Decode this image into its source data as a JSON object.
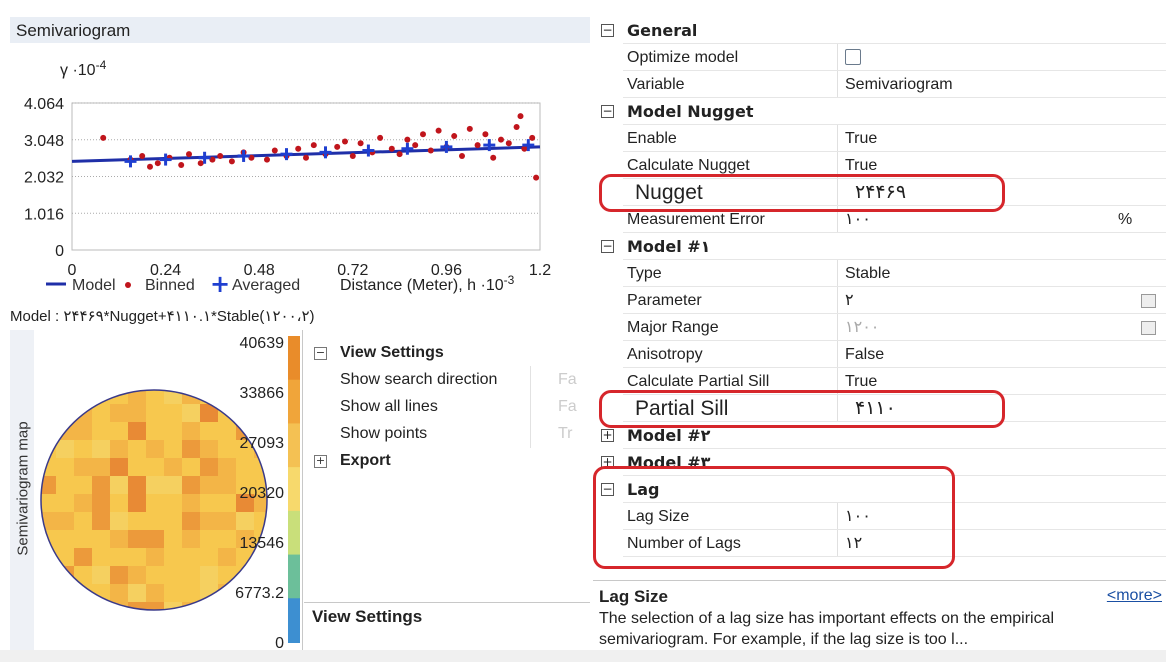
{
  "semivariogram": {
    "title": "Semivariogram",
    "y_unit": "γ ·10",
    "y_exp": "-4",
    "x_title": "Distance (Meter), h ·10",
    "x_exp": "-3",
    "legend": {
      "model": "Model",
      "binned": "Binned",
      "averaged": "Averaged"
    },
    "model_formula": "Model : ۲۴۴۶۹*Nugget+۴۱۱۰.۱*Stable(۱۲۰۰،۲)",
    "colors": {
      "model": "#1f2fa8",
      "binned": "#c0151c",
      "averaged": "#1f3fd0"
    }
  },
  "chart_data": {
    "type": "scatter",
    "title": "Semivariogram",
    "xlabel": "Distance (Meter), h ·10^-3",
    "ylabel": "γ ·10^-4",
    "xlim": [
      0,
      1.2
    ],
    "ylim": [
      0,
      4.064
    ],
    "x_ticks": [
      "0",
      "0.24",
      "0.48",
      "0.72",
      "0.96",
      "1.2"
    ],
    "y_ticks": [
      "0",
      "1.016",
      "2.032",
      "3.048",
      "4.064"
    ],
    "grid": true,
    "legend_position": "bottom",
    "series": [
      {
        "name": "Model",
        "kind": "line",
        "points": [
          [
            0.0,
            2.45
          ],
          [
            1.2,
            2.85
          ]
        ]
      },
      {
        "name": "Binned",
        "kind": "scatter",
        "points": [
          [
            0.08,
            3.1
          ],
          [
            0.15,
            2.5
          ],
          [
            0.18,
            2.6
          ],
          [
            0.2,
            2.3
          ],
          [
            0.22,
            2.4
          ],
          [
            0.25,
            2.55
          ],
          [
            0.28,
            2.35
          ],
          [
            0.3,
            2.65
          ],
          [
            0.33,
            2.4
          ],
          [
            0.36,
            2.5
          ],
          [
            0.38,
            2.6
          ],
          [
            0.41,
            2.45
          ],
          [
            0.44,
            2.7
          ],
          [
            0.46,
            2.55
          ],
          [
            0.5,
            2.5
          ],
          [
            0.52,
            2.75
          ],
          [
            0.55,
            2.6
          ],
          [
            0.58,
            2.8
          ],
          [
            0.6,
            2.55
          ],
          [
            0.62,
            2.9
          ],
          [
            0.65,
            2.65
          ],
          [
            0.68,
            2.85
          ],
          [
            0.7,
            3.0
          ],
          [
            0.72,
            2.6
          ],
          [
            0.74,
            2.95
          ],
          [
            0.77,
            2.7
          ],
          [
            0.79,
            3.1
          ],
          [
            0.82,
            2.8
          ],
          [
            0.84,
            2.65
          ],
          [
            0.86,
            3.05
          ],
          [
            0.88,
            2.9
          ],
          [
            0.9,
            3.2
          ],
          [
            0.92,
            2.75
          ],
          [
            0.94,
            3.3
          ],
          [
            0.96,
            2.85
          ],
          [
            0.98,
            3.15
          ],
          [
            1.0,
            2.6
          ],
          [
            1.02,
            3.35
          ],
          [
            1.04,
            2.9
          ],
          [
            1.06,
            3.2
          ],
          [
            1.08,
            2.55
          ],
          [
            1.1,
            3.05
          ],
          [
            1.12,
            2.95
          ],
          [
            1.14,
            3.4
          ],
          [
            1.16,
            2.8
          ],
          [
            1.18,
            3.1
          ],
          [
            1.19,
            2.0
          ],
          [
            1.15,
            3.7
          ]
        ]
      },
      {
        "name": "Averaged",
        "kind": "scatter",
        "points": [
          [
            0.15,
            2.45
          ],
          [
            0.24,
            2.5
          ],
          [
            0.34,
            2.55
          ],
          [
            0.44,
            2.6
          ],
          [
            0.55,
            2.65
          ],
          [
            0.65,
            2.7
          ],
          [
            0.76,
            2.75
          ],
          [
            0.86,
            2.8
          ],
          [
            0.96,
            2.85
          ],
          [
            1.07,
            2.9
          ],
          [
            1.17,
            2.9
          ]
        ]
      }
    ]
  },
  "map": {
    "vertical_label": "Semivariogram map",
    "legend_values": [
      "40639",
      "33866",
      "27093",
      "20320",
      "13546",
      "6773.2",
      "0"
    ],
    "legend_colors": [
      "#e98c2a",
      "#f0a53a",
      "#f4c153",
      "#f7d96c",
      "#c9df7a",
      "#6cbf9a",
      "#3d8fd1"
    ]
  },
  "view_settings": {
    "category": "View Settings",
    "items": [
      {
        "label": "Show search direction",
        "value": "Fa"
      },
      {
        "label": "Show all lines",
        "value": "Fa"
      },
      {
        "label": "Show points",
        "value": "Tr"
      }
    ],
    "export": "Export",
    "description_title": "View Settings"
  },
  "properties": {
    "rows": [
      {
        "type": "cat",
        "label": "General",
        "exp": "minus"
      },
      {
        "type": "prop",
        "label": "Optimize model",
        "value": "",
        "icon": "optimize-icon"
      },
      {
        "type": "prop",
        "label": "Variable",
        "value": "Semivariogram"
      },
      {
        "type": "cat",
        "label": "Model Nugget",
        "exp": "minus"
      },
      {
        "type": "prop",
        "label": "Enable",
        "value": "True"
      },
      {
        "type": "prop",
        "label": "Calculate Nugget",
        "value": "True"
      },
      {
        "type": "prop",
        "label": "Nugget",
        "value": "۲۴۴۶۹",
        "big": true
      },
      {
        "type": "prop",
        "label": "Measurement Error",
        "value": "۱۰۰",
        "suffix": "%"
      },
      {
        "type": "cat",
        "label": "Model #۱",
        "exp": "minus"
      },
      {
        "type": "prop",
        "label": "Type",
        "value": "Stable"
      },
      {
        "type": "prop",
        "label": "Parameter",
        "value": "۲",
        "calc": true
      },
      {
        "type": "prop",
        "label": "Major Range",
        "value": "۱۲۰۰",
        "dim": true,
        "calc": true
      },
      {
        "type": "prop",
        "label": "Anisotropy",
        "value": "False"
      },
      {
        "type": "prop",
        "label": "Calculate Partial Sill",
        "value": "True"
      },
      {
        "type": "prop",
        "label": "Partial Sill",
        "value": "۴۱۱۰",
        "big": true
      },
      {
        "type": "cat",
        "label": "Model #۲",
        "exp": "plus"
      },
      {
        "type": "cat",
        "label": "Model #۳",
        "exp": "plus"
      },
      {
        "type": "cat",
        "label": "Lag",
        "exp": "minus"
      },
      {
        "type": "prop",
        "label": "Lag Size",
        "value": "۱۰۰",
        "selected": true
      },
      {
        "type": "prop",
        "label": "Number of Lags",
        "value": "۱۲"
      }
    ],
    "description": {
      "title": "Lag Size",
      "more": "<more>",
      "text": "The selection of a lag size has important effects on the empirical semivariogram. For example, if the lag size is too l..."
    }
  }
}
